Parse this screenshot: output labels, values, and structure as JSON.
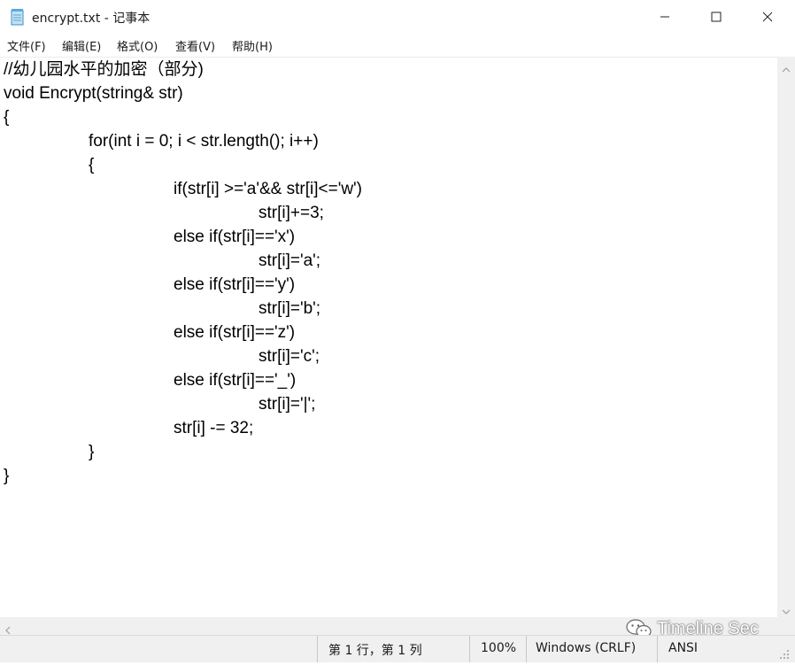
{
  "window": {
    "title": "encrypt.txt - 记事本",
    "icon": "notepad-icon"
  },
  "menu": {
    "items": [
      {
        "label": "文件(F)"
      },
      {
        "label": "编辑(E)"
      },
      {
        "label": "格式(O)"
      },
      {
        "label": "查看(V)"
      },
      {
        "label": "帮助(H)"
      }
    ]
  },
  "editor": {
    "lines": [
      "//幼儿园水平的加密（部分)",
      "void Encrypt(string& str)",
      "{",
      "for(int i = 0; i < str.length(); i++)",
      "{",
      "if(str[i] >='a'&& str[i]<='w')",
      "str[i]+=3;",
      "else if(str[i]=='x')",
      "str[i]='a';",
      "else if(str[i]=='y')",
      "str[i]='b';",
      "else if(str[i]=='z')",
      "str[i]='c';",
      "else if(str[i]=='_')",
      "str[i]='|';",
      "str[i] -= 32;",
      "}",
      "}"
    ]
  },
  "status": {
    "position": "第 1 行，第 1 列",
    "zoom": "100%",
    "line_ending": "Windows (CRLF)",
    "encoding": "ANSI"
  },
  "watermark": {
    "text": "Timeline Sec",
    "icon": "wechat-icon"
  }
}
